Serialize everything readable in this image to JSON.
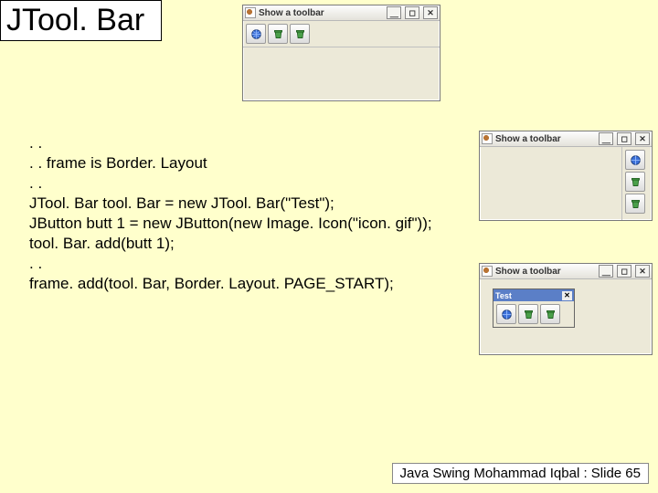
{
  "title": "JTool. Bar",
  "code_lines": [
    ". .",
    ". . frame is Border. Layout",
    ". .",
    "JTool. Bar tool. Bar = new JTool. Bar(\"Test\");",
    "JButton butt 1 = new JButton(new Image. Icon(\"icon. gif\"));",
    "tool. Bar. add(butt 1);",
    ". .",
    "frame. add(tool. Bar, Border. Layout. PAGE_START);"
  ],
  "footer": "Java Swing Mohammad Iqbal : Slide 65",
  "windows": {
    "w1": {
      "title": "Show a toolbar"
    },
    "w2": {
      "title": "Show a toolbar"
    },
    "w3": {
      "title": "Show a toolbar",
      "palette_title": "Test"
    }
  },
  "winbtn": {
    "min": "⎽",
    "max": "◻",
    "close": "✕"
  }
}
